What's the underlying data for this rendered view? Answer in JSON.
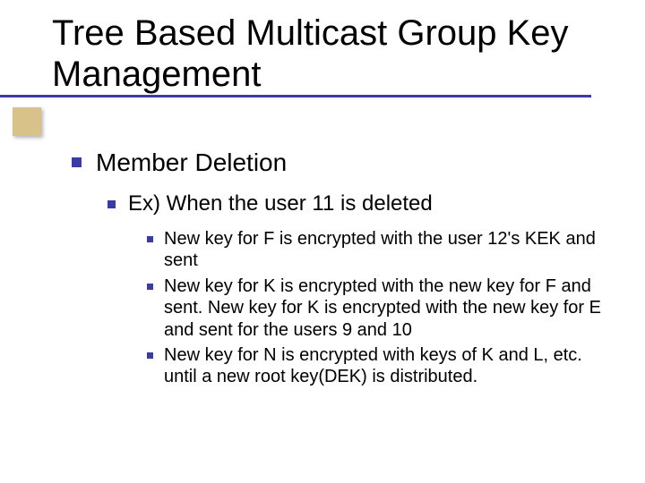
{
  "title": "Tree Based Multicast Group Key Management",
  "level1": {
    "text": "Member Deletion"
  },
  "level2": {
    "text": "Ex) When the user 11 is deleted"
  },
  "level3": [
    {
      "text": "New key for F is encrypted with the user 12's KEK and sent"
    },
    {
      "text": "New key for K is encrypted with the new key for F and sent. New key for K is encrypted with the new key for E and sent for the users 9 and 10"
    },
    {
      "text": "New key for N is encrypted with keys of K and L, etc. until a new root key(DEK) is distributed."
    }
  ]
}
